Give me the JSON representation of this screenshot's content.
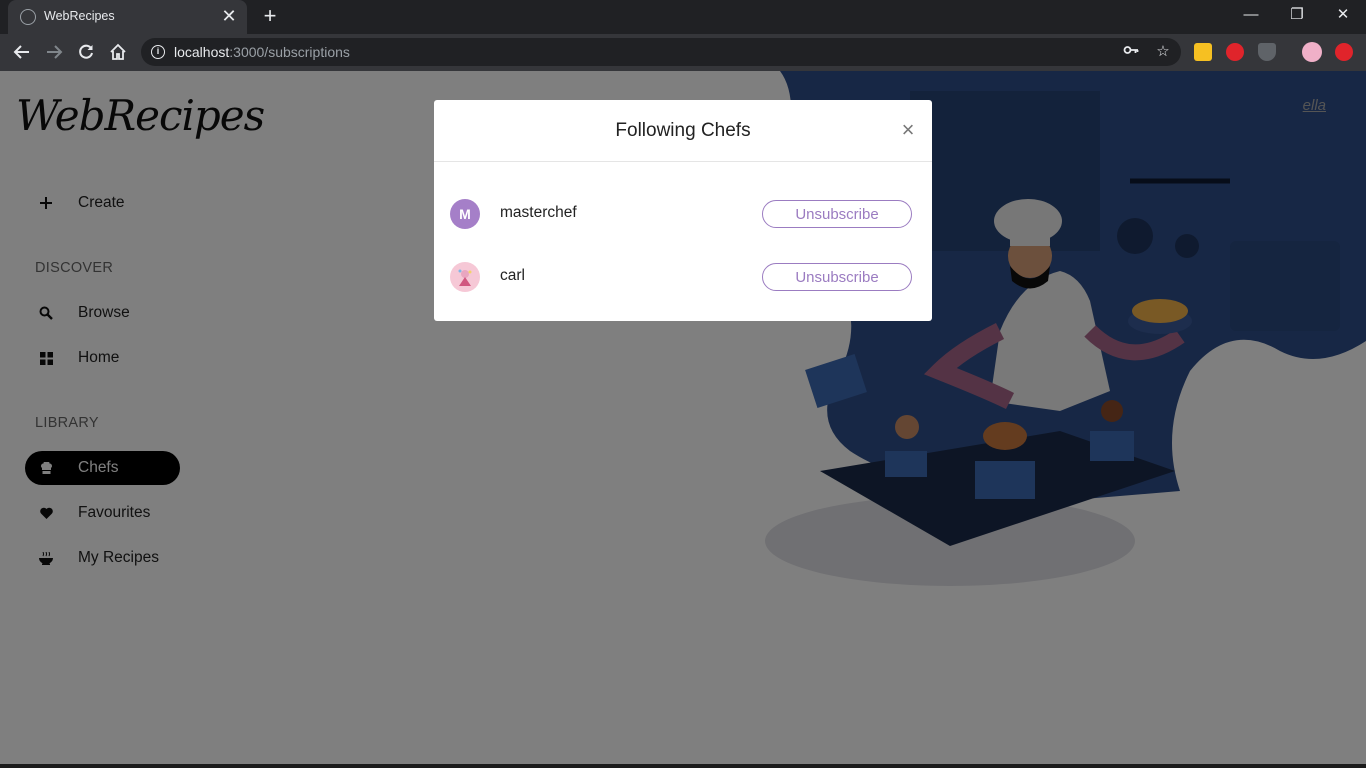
{
  "browser": {
    "tab_title": "WebRecipes",
    "tab_close": "✕",
    "new_tab": "+",
    "url_host": "localhost",
    "url_path": ":3000/subscriptions",
    "window_controls": {
      "minimize": "—",
      "restore": "❐",
      "close": "✕"
    },
    "icons": [
      "back-icon",
      "forward-icon",
      "reload-icon",
      "home-icon",
      "info-icon",
      "key-icon",
      "star-icon"
    ]
  },
  "app": {
    "logo": "WebRecipes",
    "user": "ella",
    "create_label": "Create",
    "discover_title": "DISCOVER",
    "discover_items": [
      {
        "label": "Browse",
        "icon": "search-icon"
      },
      {
        "label": "Home",
        "icon": "grid-icon"
      }
    ],
    "library_title": "LIBRARY",
    "library_items": [
      {
        "label": "Chefs",
        "icon": "chef-hat-icon",
        "active": true
      },
      {
        "label": "Favourites",
        "icon": "heart-icon",
        "active": false
      },
      {
        "label": "My Recipes",
        "icon": "bowl-icon",
        "active": false
      }
    ]
  },
  "modal": {
    "title": "Following Chefs",
    "close": "×",
    "chefs": [
      {
        "name": "masterchef",
        "avatar_letter": "M",
        "avatar_color": "#a57fc8",
        "button": "Unsubscribe"
      },
      {
        "name": "carl",
        "avatar_letter": "",
        "avatar_color": "#f6c8d6",
        "button": "Unsubscribe"
      }
    ]
  },
  "colors": {
    "accent": "#9b7cc1",
    "active_nav_bg": "#000000",
    "hero_blue": "#2f4f8a"
  }
}
